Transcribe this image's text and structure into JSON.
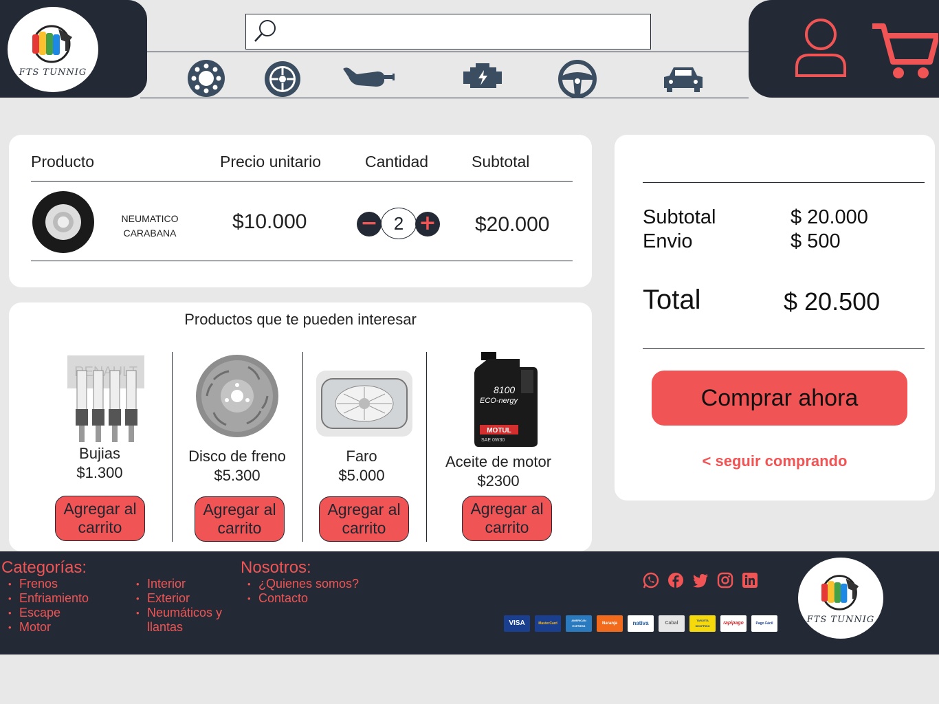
{
  "brand": {
    "name": "FTS TUNNIG"
  },
  "header": {
    "search_placeholder": "",
    "categories": [
      "frenos-icon",
      "rueda-icon",
      "escape-icon",
      "motor-icon",
      "volante-icon",
      "auto-icon"
    ]
  },
  "cart": {
    "headers": {
      "product": "Producto",
      "unit_price": "Precio unitario",
      "quantity": "Cantidad",
      "subtotal": "Subtotal"
    },
    "item": {
      "name": "NEUMATICO CARABANA",
      "unit_price": "$10.000",
      "quantity": "2",
      "subtotal": "$20.000"
    },
    "minus": "−",
    "plus": "+"
  },
  "suggestions": {
    "title": "Productos que te pueden interesar",
    "items": [
      {
        "name": "Bujias",
        "price": "$1.300",
        "button": "Agregar al carrito"
      },
      {
        "name": "Disco de freno",
        "price": "$5.300",
        "button": "Agregar al carrito"
      },
      {
        "name": "Faro",
        "price": "$5.000",
        "button": "Agregar al carrito"
      },
      {
        "name": "Aceite de motor",
        "price": "$2300",
        "button": "Agregar al carrito"
      }
    ]
  },
  "summary": {
    "subtotal_label": "Subtotal",
    "subtotal_value": "$ 20.000",
    "shipping_label": "Envio",
    "shipping_value": "$ 500",
    "total_label": "Total",
    "total_value": "$ 20.500",
    "buy_button": "Comprar ahora",
    "continue_link": "< seguir comprando"
  },
  "footer": {
    "categories_title": "Categorías:",
    "categories_col1": [
      "Frenos",
      "Enfriamiento",
      "Escape",
      "Motor"
    ],
    "categories_col2": [
      "Interior",
      "Exterior",
      "Neumáticos y llantas"
    ],
    "us_title": "Nosotros:",
    "us_items": [
      "¿Quienes somos?",
      "Contacto"
    ],
    "social": [
      "whatsapp-icon",
      "facebook-icon",
      "twitter-icon",
      "instagram-icon",
      "linkedin-icon"
    ],
    "payments": [
      "VISA",
      "MasterCard",
      "AMERICAN EXPRESS",
      "Naranja",
      "nativa",
      "Cabal",
      "TARJETA SHOPPING",
      "rapipago",
      "Pago Fácil"
    ]
  },
  "colors": {
    "dark": "#232a35",
    "accent": "#f05454",
    "background": "#e8e8e8",
    "panel": "#ffffff"
  }
}
